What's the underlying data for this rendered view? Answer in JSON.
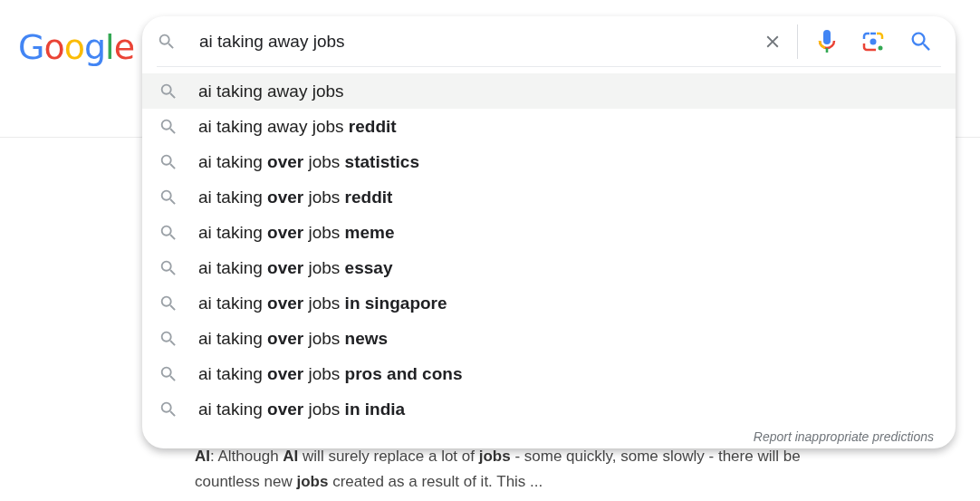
{
  "logo": {
    "text": "Google"
  },
  "search": {
    "value": "ai taking away jobs"
  },
  "suggestions": [
    {
      "text": "ai taking away jobs",
      "selected": true
    },
    {
      "text": "ai taking away jobs **reddit**",
      "selected": false
    },
    {
      "text": "ai taking **over** jobs **statistics**",
      "selected": false
    },
    {
      "text": "ai taking **over** jobs **reddit**",
      "selected": false
    },
    {
      "text": "ai taking **over** jobs **meme**",
      "selected": false
    },
    {
      "text": "ai taking **over** jobs **essay**",
      "selected": false
    },
    {
      "text": "ai taking **over** jobs **in singapore**",
      "selected": false
    },
    {
      "text": "ai taking **over** jobs **news**",
      "selected": false
    },
    {
      "text": "ai taking **over** jobs **pros and cons**",
      "selected": false
    },
    {
      "text": "ai taking **over** jobs **in india**",
      "selected": false
    }
  ],
  "report_link": "Report inappropriate predictions",
  "result_snippet": "**AI**: Although **AI** will surely replace a lot of **jobs** - some quickly, some slowly - there will be countless new **jobs** created as a result of it. This ..."
}
